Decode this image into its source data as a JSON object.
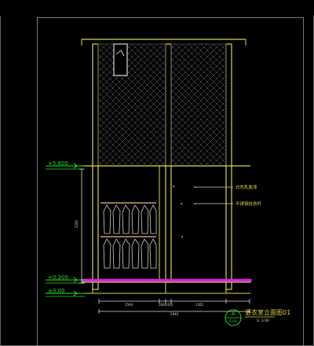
{
  "drawing": {
    "title": "更衣室立面图01",
    "scale": "S: 1/30",
    "detail_ref": {
      "letter": "A",
      "sheet": "E-01"
    }
  },
  "levels": [
    {
      "label": "+5.800"
    },
    {
      "label": "+0.300"
    },
    {
      "label": "±0.00"
    }
  ],
  "dimensions": {
    "horizontal": [
      "1594",
      "1620(20)",
      "1262"
    ],
    "total": "2940",
    "vertical": "3200"
  },
  "annotations": [
    {
      "label": "白色乳胶漆"
    },
    {
      "label": "不锈钢挂衣杆"
    }
  ],
  "colors": {
    "background": "#000000",
    "wall": "#d8d84a",
    "hatch": "#8a8a8a",
    "level": "#22e022",
    "dimension": "#d8d8d8",
    "frame": "#6f6f6f",
    "floor_band": "#d12ad8",
    "hanger_rail": "#c8a070",
    "garment": "#cfcfcf"
  }
}
